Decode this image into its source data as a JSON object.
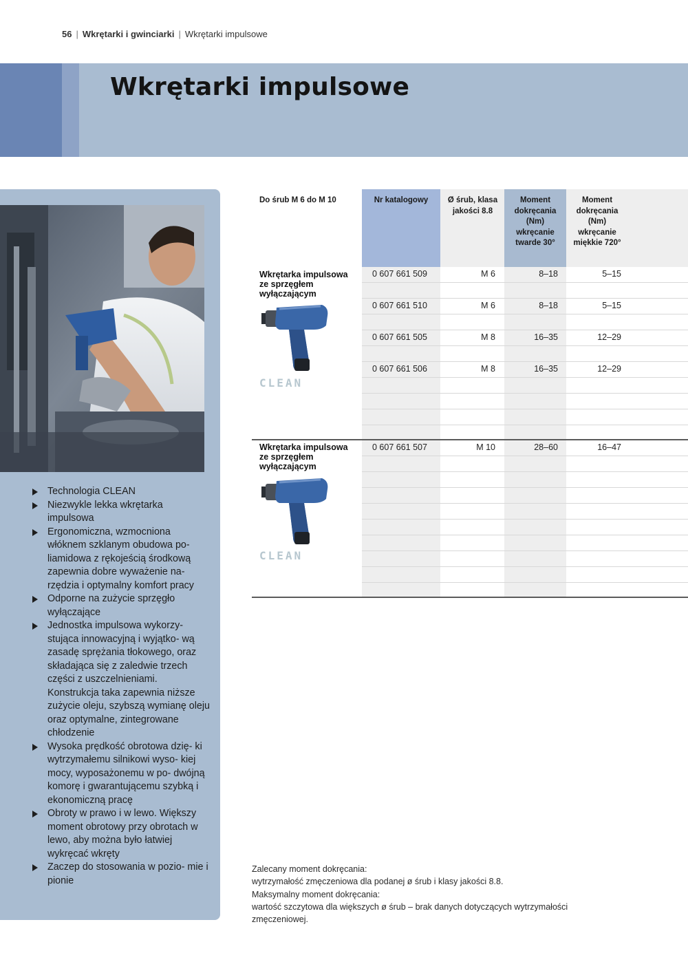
{
  "breadcrumb": {
    "page_number": "56",
    "section": "Wkrętarki i gwinciarki",
    "subsection": "Wkrętarki impulsowe"
  },
  "title": "Wkrętarki impulsowe",
  "features": [
    "Technologia CLEAN",
    "Niezwykle lekka wkrętarka impulsowa",
    "Ergonomiczna, wzmocniona włóknem szklanym obudowa po- liamidowa z rękojeścią środkową zapewnia dobre wyważenie na- rzędzia i optymalny komfort pracy",
    "Odporne na zużycie sprzęgło wyłączające",
    "Jednostka impulsowa wykorzy- stująca innowacyjną i wyjątko- wą zasadę sprężania tłokowego, oraz składająca się z zaledwie trzech części z uszczelnieniami. Konstrukcja taka zapewnia niższe zużycie oleju, szybszą wymianę oleju oraz optymalne, zintegrowane chłodzenie",
    "Wysoka prędkość obrotowa dzię- ki wytrzymałemu silnikowi wyso- kiej mocy, wyposażonemu w po- dwójną komorę i gwarantującemu szybką i ekonomiczną pracę",
    "Obroty w prawo i w lewo. Większy moment obrotowy przy obrotach w lewo, aby można było łatwiej wykręcać wkręty",
    "Zaczep do stosowania w pozio- mie i pionie"
  ],
  "table": {
    "headers": {
      "col0": "Do śrub M 6 do M 10",
      "col1": "Nr katalogowy",
      "col2": "Ø śrub, klasa jakości 8.8",
      "col3": "Moment dokręcania (Nm) wkręcanie twarde 30°",
      "col4": "Moment dokręcania (Nm) wkręcanie miękkie 720°"
    },
    "groups": [
      {
        "name": "Wkrętarka impulsowa ze sprzęgłem wyłączającym",
        "badge": "CLEAN",
        "rows": [
          {
            "catalog": "0 607 661 509",
            "screw": "M 6",
            "hard": "8–18",
            "soft": "5–15"
          },
          {
            "catalog": "0 607 661 510",
            "screw": "M 6",
            "hard": "8–18",
            "soft": "5–15"
          },
          {
            "catalog": "0 607 661 505",
            "screw": "M 8",
            "hard": "16–35",
            "soft": "12–29"
          },
          {
            "catalog": "0 607 661 506",
            "screw": "M 8",
            "hard": "16–35",
            "soft": "12–29"
          }
        ]
      },
      {
        "name": "Wkrętarka impulsowa ze sprzęgłem wyłączającym",
        "badge": "CLEAN",
        "rows": [
          {
            "catalog": "0 607 661 507",
            "screw": "M 10",
            "hard": "28–60",
            "soft": "16–47"
          }
        ]
      }
    ]
  },
  "footnote": [
    "Zalecany moment dokręcania:",
    "wytrzymałość zmęczeniowa dla podanej ø śrub i klasy jakości 8.8.",
    "Maksymalny moment dokręcania:",
    "wartość szczytowa dla większych ø śrub – brak danych dotyczących wytrzymałości",
    "zmęczeniowej."
  ],
  "colors": {
    "band": "#a9bcd1",
    "band_dark": "#6a85b4",
    "catalog_column": "#a3b7da",
    "hard_column": "#a8bad0",
    "shade": "#eeeeee",
    "tool_body": "#3a67a8"
  },
  "icons": [
    "impact-wrench-icon",
    "impact-wrench-icon"
  ]
}
